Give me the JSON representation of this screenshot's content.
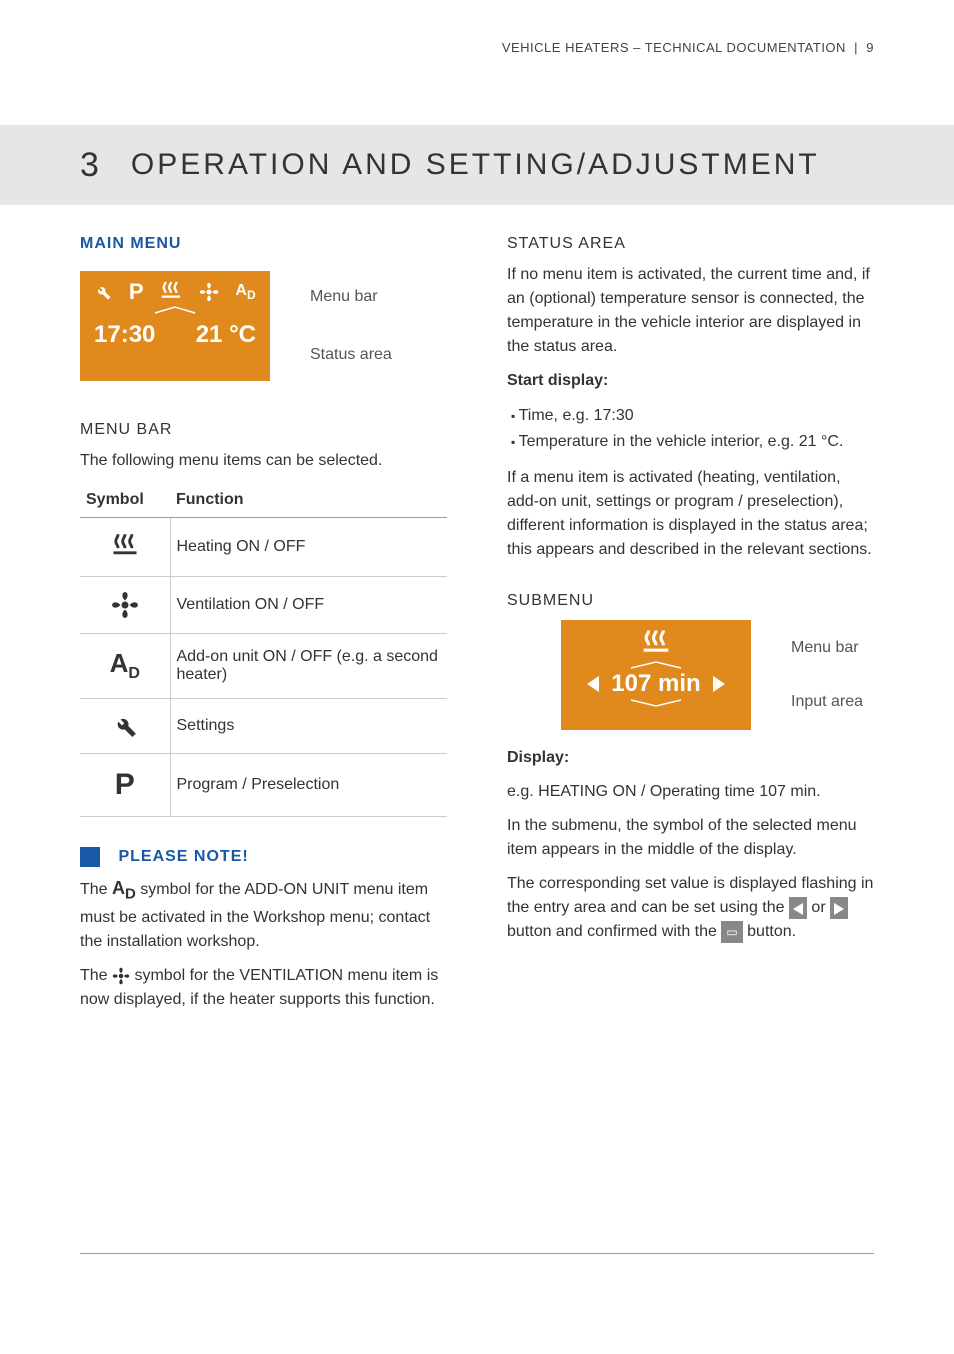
{
  "header": {
    "doc_title": "VEHICLE HEATERS – TECHNICAL DOCUMENTATION",
    "page_no": "9"
  },
  "chapter": {
    "number": "3",
    "title": "OPERATION AND SETTING/ADJUSTMENT"
  },
  "left": {
    "main_menu_heading": "MAIN MENU",
    "display": {
      "time": "17:30",
      "temp": "21 °C"
    },
    "label_menubar": "Menu bar",
    "label_status": "Status area",
    "menubar_heading": "MENU BAR",
    "menubar_intro": "The following menu items can be selected.",
    "table": {
      "h_symbol": "Symbol",
      "h_function": "Function",
      "rows": [
        {
          "icon": "heat",
          "fn": "Heating ON / OFF"
        },
        {
          "icon": "fan",
          "fn": "Ventilation ON / OFF"
        },
        {
          "icon": "ad",
          "fn": "Add-on unit ON / OFF (e.g. a second heater)"
        },
        {
          "icon": "wrench",
          "fn": "Settings"
        },
        {
          "icon": "P",
          "fn": "Program / Preselection"
        }
      ]
    },
    "note_title": "PLEASE NOTE!",
    "note_p1_a": "The ",
    "note_p1_b": " symbol for the ADD-ON UNIT menu item must be activated in the Workshop menu; contact the installation workshop.",
    "note_p2_a": "The ",
    "note_p2_b": " symbol for the VENTILATION menu item is now displayed, if the heater supports this function."
  },
  "right": {
    "status_heading": "STATUS AREA",
    "status_p1": "If no menu item is activated, the current time and, if an (optional) temperature sensor is connected, the temperature in the vehicle interior are displayed in the status area.",
    "start_display": "Start display:",
    "bullets": [
      "Time, e.g. 17:30",
      "Temperature in the vehicle interior, e.g. 21 °C."
    ],
    "status_p2": "If a menu item is activated (heating, ventilation, add-on unit, settings or program / preselection), different information is displayed in the status area; this appears and described in the relevant sections.",
    "submenu_heading": "SUBMENU",
    "submenu_display_value": "107 min",
    "label_menubar": "Menu bar",
    "label_input": "Input area",
    "display_label": "Display:",
    "display_eg": "e.g. HEATING ON / Operating time 107 min.",
    "sub_p1": "In the submenu, the symbol of the selected menu item appears in the middle of the display.",
    "sub_p2_a": "The corresponding set value is displayed flashing in the entry area and can be set using the ",
    "sub_p2_b": " or ",
    "sub_p2_c": " button and confirmed with the ",
    "sub_p2_d": " button."
  }
}
